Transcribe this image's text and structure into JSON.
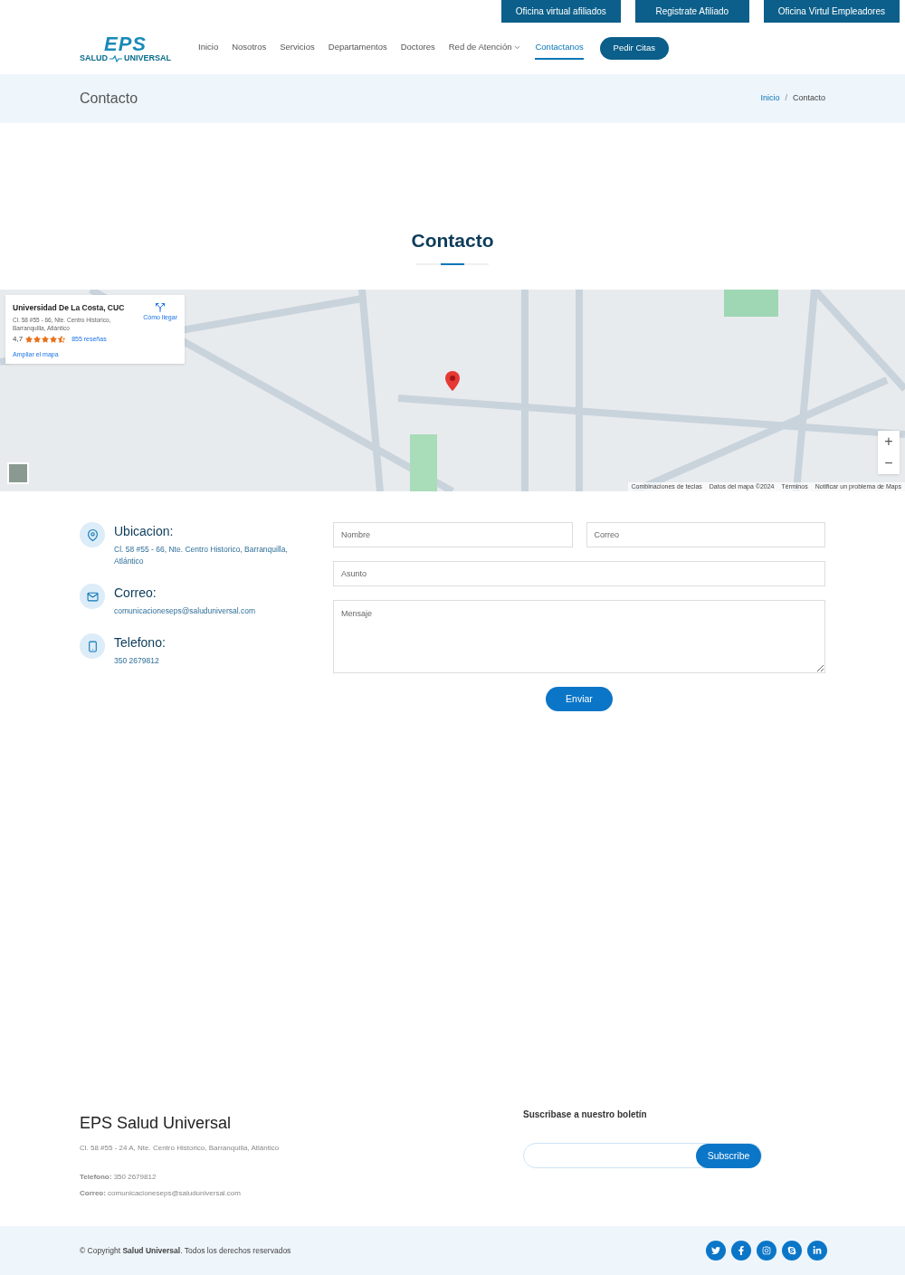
{
  "top_bar": {
    "buttons": [
      "Oficina virtual afiliados",
      "Registrate Afiliado",
      "Oficina Virtul Empleadores"
    ]
  },
  "header": {
    "logo": {
      "top": "EPS",
      "bottom_left": "SALUD",
      "bottom_right": "UNIVERSAL"
    },
    "nav": [
      {
        "label": "Inicio",
        "selected": false,
        "kind": "link"
      },
      {
        "label": "Nosotros",
        "selected": false,
        "kind": "link"
      },
      {
        "label": "Servicios",
        "selected": false,
        "kind": "link"
      },
      {
        "label": "Departamentos",
        "selected": false,
        "kind": "link"
      },
      {
        "label": "Doctores",
        "selected": false,
        "kind": "link"
      },
      {
        "label": "Red de Atención",
        "selected": false,
        "kind": "dropdown"
      },
      {
        "label": "Contactanos",
        "selected": true,
        "kind": "link"
      }
    ],
    "cta": "Pedir Citas"
  },
  "page_header": {
    "title": "Contacto",
    "breadcrumb": [
      {
        "label": "Inicio",
        "kind": "link"
      },
      {
        "label": "Contacto",
        "kind": "current"
      }
    ],
    "separator": "/"
  },
  "section_title": "Contacto",
  "map": {
    "place_card": {
      "name": "Universidad De La Costa, CUC",
      "address": "Cl. 58 #55 - 66, Nte. Centro Historico, Barranquilla, Atlántico",
      "rating": "4,7",
      "stars": 4.5,
      "reviews": "855 reseñas",
      "directions": "Cómo llegar",
      "enlarge": "Ampliar el mapa"
    },
    "zoom": [
      "+",
      "−"
    ],
    "credits": [
      "Combinaciones de teclas",
      "Datos del mapa ©2024",
      "Términos",
      "Notificar un problema de Maps"
    ]
  },
  "contact_info": [
    {
      "kind": "location",
      "title": "Ubicacion:",
      "value": "Cl. 58 #55 - 66, Nte. Centro Historico, Barranquilla, Atlántico"
    },
    {
      "kind": "email",
      "title": "Correo:",
      "value": "comunicacioneseps@saluduniversal.com"
    },
    {
      "kind": "phone",
      "title": "Telefono:",
      "value": "350 2679812"
    }
  ],
  "form": {
    "name": {
      "placeholder": "Nombre"
    },
    "email": {
      "placeholder": "Correo"
    },
    "subject": {
      "placeholder": "Asunto"
    },
    "message": {
      "placeholder": "Mensaje"
    },
    "submit": "Enviar"
  },
  "footer": {
    "title": "EPS Salud Universal",
    "address": "Cl. 58 #55 - 24 A, Nte. Centro Historico, Barranquilla, Atlántico",
    "phone": "**Telefono:** 350 2679812",
    "email": "**Correo:** comunicacioneseps@saluduniversal.com",
    "newsletter_title": "Suscribase a nuestro boletín",
    "subscribe": "Subscribe"
  },
  "bottom_bar": {
    "copyright": "© Copyright **Salud Universal**. Todos los derechos reservados",
    "social": [
      {
        "kind": "twitter"
      },
      {
        "kind": "facebook"
      },
      {
        "kind": "instagram"
      },
      {
        "kind": "skype"
      },
      {
        "kind": "linkedin"
      }
    ]
  }
}
